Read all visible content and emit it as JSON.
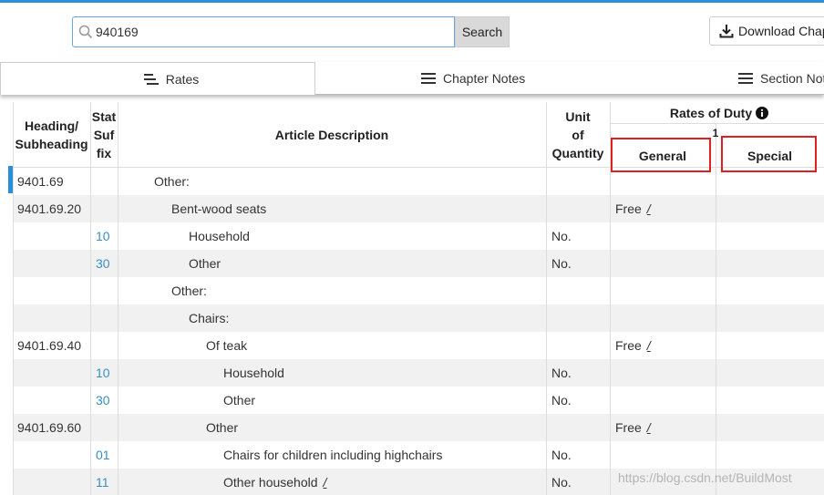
{
  "search": {
    "value": "940169",
    "button_label": "Search"
  },
  "download": {
    "label": "Download Chap"
  },
  "tabs": [
    {
      "label": "Rates",
      "active": true
    },
    {
      "label": "Chapter Notes",
      "active": false
    },
    {
      "label": "Section Not",
      "active": false
    }
  ],
  "table": {
    "headers": {
      "heading_line1": "Heading/",
      "heading_line2": "Subheading",
      "stat_line1": "Stat",
      "stat_line2": "Suf",
      "stat_line3": "fix",
      "description": "Article Description",
      "unit_line1": "Unit",
      "unit_line2": "of",
      "unit_line3": "Quantity",
      "rates_of_duty": "Rates of Duty",
      "column_one": "1",
      "general": "General",
      "special": "Special"
    },
    "rows": [
      {
        "heading": "9401.69",
        "suffix": "",
        "description": "Other:",
        "indent": 0,
        "unit": "",
        "general": ""
      },
      {
        "heading": "9401.69.20",
        "suffix": "",
        "description": "Bent-wood seats",
        "indent": 1,
        "unit": "",
        "general": "Free"
      },
      {
        "heading": "",
        "suffix": "10",
        "description": "Household",
        "indent": 2,
        "unit": "No.",
        "general": ""
      },
      {
        "heading": "",
        "suffix": "30",
        "description": "Other",
        "indent": 2,
        "unit": "No.",
        "general": ""
      },
      {
        "heading": "",
        "suffix": "",
        "description": "Other:",
        "indent": 1,
        "unit": "",
        "general": ""
      },
      {
        "heading": "",
        "suffix": "",
        "description": "Chairs:",
        "indent": 2,
        "unit": "",
        "general": ""
      },
      {
        "heading": "9401.69.40",
        "suffix": "",
        "description": "Of teak",
        "indent": 3,
        "unit": "",
        "general": "Free"
      },
      {
        "heading": "",
        "suffix": "10",
        "description": "Household",
        "indent": 4,
        "unit": "No.",
        "general": ""
      },
      {
        "heading": "",
        "suffix": "30",
        "description": "Other",
        "indent": 4,
        "unit": "No.",
        "general": ""
      },
      {
        "heading": "9401.69.60",
        "suffix": "",
        "description": "Other",
        "indent": 3,
        "unit": "",
        "general": "Free"
      },
      {
        "heading": "",
        "suffix": "01",
        "description": "Chairs for children including highchairs",
        "indent": 4,
        "unit": "No.",
        "general": ""
      },
      {
        "heading": "",
        "suffix": "11",
        "description": "Other household",
        "indent": 4,
        "unit": "No.",
        "general": ""
      }
    ],
    "footnote_mark": "/"
  },
  "watermark": "https://blog.csdn.net/BuildMost",
  "colors": {
    "accent": "#2a8fd6",
    "highlight_box": "#e02020",
    "suffix_link": "#3a8fc0",
    "alt_row": "#f1f1f1"
  }
}
